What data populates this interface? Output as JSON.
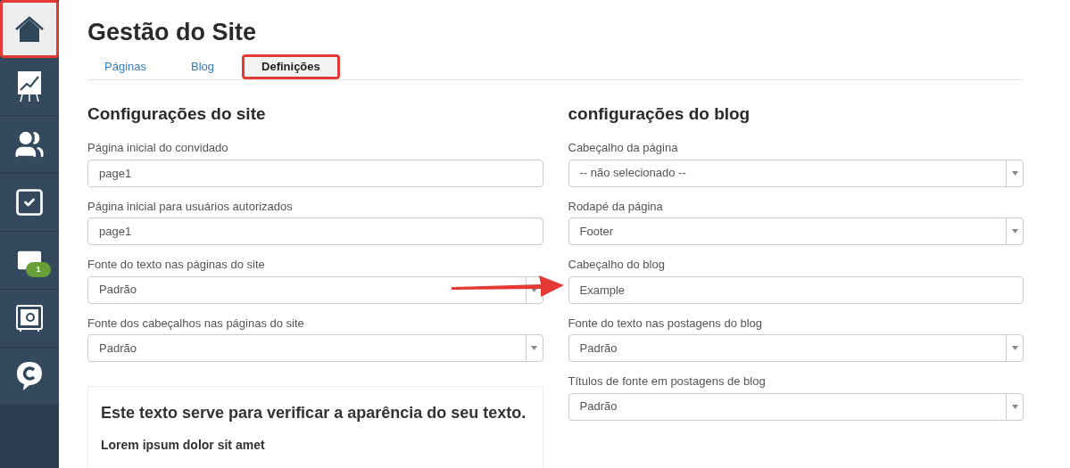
{
  "sidebar": {
    "items": [
      {
        "kind": "home",
        "selected": true,
        "highlighted": true
      },
      {
        "kind": "chart",
        "selected": false,
        "highlighted": false
      },
      {
        "kind": "users",
        "selected": false,
        "highlighted": false
      },
      {
        "kind": "tasks",
        "selected": false,
        "highlighted": false
      },
      {
        "kind": "mail",
        "selected": false,
        "highlighted": false,
        "badge": "1"
      },
      {
        "kind": "safe",
        "selected": false,
        "highlighted": false
      },
      {
        "kind": "chat",
        "selected": false,
        "highlighted": false
      }
    ]
  },
  "title": "Gestão do Site",
  "tabs": [
    {
      "label": "Páginas",
      "selected": false,
      "highlighted": false
    },
    {
      "label": "Blog",
      "selected": false,
      "highlighted": false
    },
    {
      "label": "Definições",
      "selected": true,
      "highlighted": true
    }
  ],
  "sections": [
    {
      "heading": "Configurações do site",
      "fields": [
        {
          "label": "Página inicial do convidado",
          "kind": "text",
          "value": "page1"
        },
        {
          "label": "Página inicial para usuários autorizados",
          "kind": "text",
          "value": "page1"
        },
        {
          "label": "Fonte do texto nas páginas do site",
          "kind": "select",
          "value": "Padrão"
        },
        {
          "label": "Fonte dos cabeçalhos nas páginas do site",
          "kind": "select",
          "value": "Padrão"
        }
      ],
      "preview": {
        "heading": "Este texto serve para verificar a aparência do seu texto.",
        "text": "Lorem ipsum dolor sit amet"
      }
    },
    {
      "heading": "configurações do blog",
      "fields": [
        {
          "label": "Cabeçalho da página",
          "kind": "select",
          "value": "-- não selecionado --"
        },
        {
          "label": "Rodapé da página",
          "kind": "select",
          "value": "Footer"
        },
        {
          "label": "Cabeçalho do blog",
          "kind": "text",
          "value": "Example"
        },
        {
          "label": "Fonte do texto nas postagens do blog",
          "kind": "select",
          "value": "Padrão"
        },
        {
          "label": "Títulos de fonte em postagens de blog",
          "kind": "select",
          "value": "Padrão"
        }
      ]
    }
  ]
}
